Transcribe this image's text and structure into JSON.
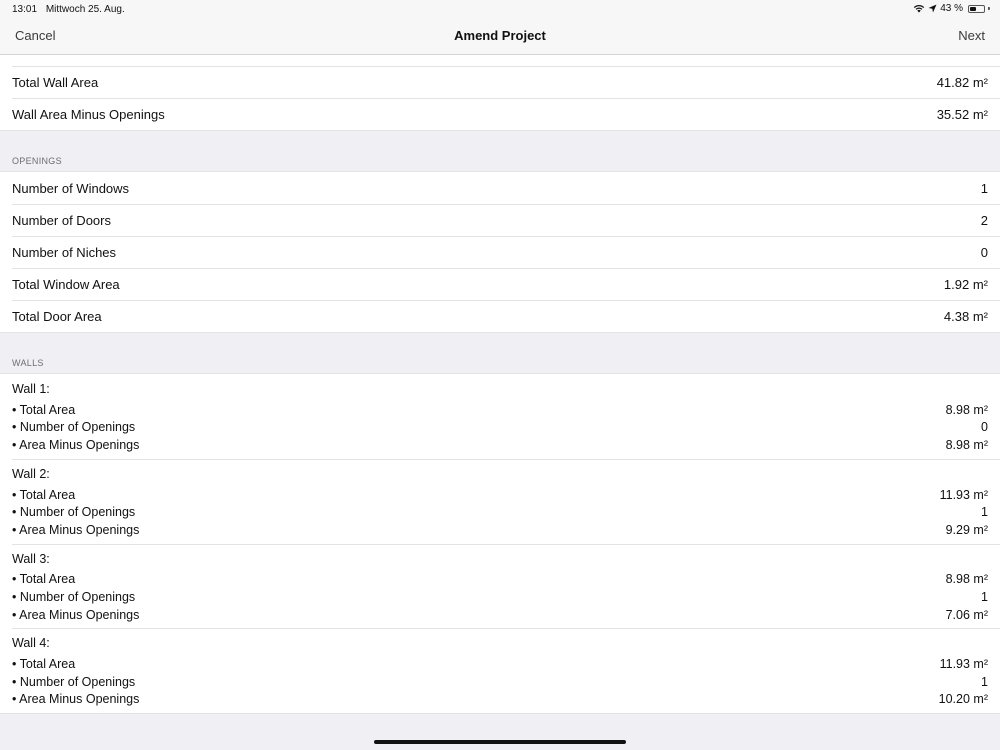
{
  "status": {
    "time": "13:01",
    "date": "Mittwoch 25. Aug.",
    "battery": "43 %",
    "battery_level": 0.43
  },
  "nav": {
    "cancel": "Cancel",
    "title": "Amend Project",
    "next": "Next"
  },
  "summary": {
    "rows": [
      {
        "label": "Total Wall Area",
        "value": "41.82 m²"
      },
      {
        "label": "Wall Area Minus Openings",
        "value": "35.52 m²"
      }
    ]
  },
  "openings": {
    "header": "OPENINGS",
    "rows": [
      {
        "label": "Number of Windows",
        "value": "1"
      },
      {
        "label": "Number of Doors",
        "value": "2"
      },
      {
        "label": "Number of Niches",
        "value": "0"
      },
      {
        "label": "Total Window Area",
        "value": "1.92 m²"
      },
      {
        "label": "Total Door Area",
        "value": "4.38 m²"
      }
    ]
  },
  "walls": {
    "header": "WALLS",
    "items": [
      {
        "title": "Wall 1:",
        "lines": [
          {
            "label": "• Total Area",
            "value": "8.98 m²"
          },
          {
            "label": "• Number of Openings",
            "value": "0"
          },
          {
            "label": "• Area Minus Openings",
            "value": "8.98 m²"
          }
        ]
      },
      {
        "title": "Wall 2:",
        "lines": [
          {
            "label": "• Total Area",
            "value": "11.93 m²"
          },
          {
            "label": "• Number of Openings",
            "value": "1"
          },
          {
            "label": "• Area Minus Openings",
            "value": "9.29 m²"
          }
        ]
      },
      {
        "title": "Wall 3:",
        "lines": [
          {
            "label": "• Total Area",
            "value": "8.98 m²"
          },
          {
            "label": "• Number of Openings",
            "value": "1"
          },
          {
            "label": "• Area Minus Openings",
            "value": "7.06 m²"
          }
        ]
      },
      {
        "title": "Wall 4:",
        "lines": [
          {
            "label": "• Total Area",
            "value": "11.93 m²"
          },
          {
            "label": "• Number of Openings",
            "value": "1"
          },
          {
            "label": "• Area Minus Openings",
            "value": "10.20 m²"
          }
        ]
      }
    ]
  }
}
